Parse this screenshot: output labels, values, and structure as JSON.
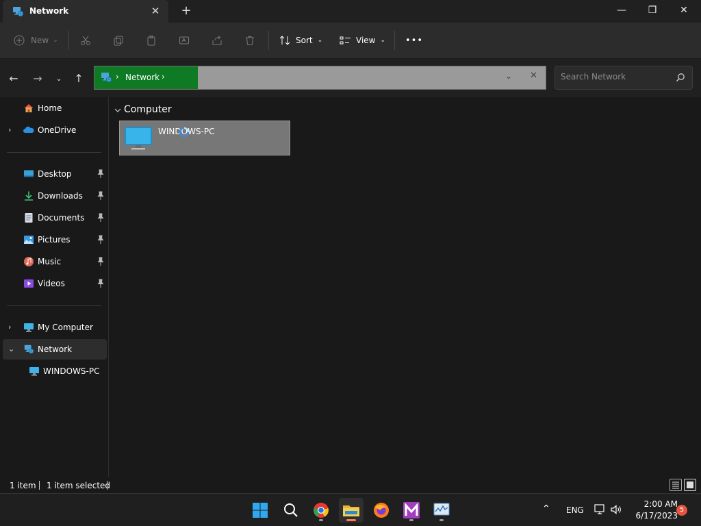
{
  "window": {
    "tab_title": "Network",
    "tab_icon": "network-icon",
    "tab_close": "✕",
    "new_tab": "+",
    "minimize": "—",
    "maximize": "❐",
    "close": "✕"
  },
  "toolbar": {
    "new_label": "New",
    "sort_label": "Sort",
    "view_label": "View",
    "more": "•••"
  },
  "address": {
    "segment": "Network",
    "chevron": "›",
    "dropdown": "⌄",
    "clear": "✕"
  },
  "search": {
    "placeholder": "Search Network"
  },
  "sidebar": {
    "items": [
      {
        "label": "Home",
        "icon": "home-icon"
      },
      {
        "label": "OneDrive",
        "icon": "onedrive-icon"
      },
      {
        "label": "Desktop",
        "icon": "desktop-icon"
      },
      {
        "label": "Downloads",
        "icon": "downloads-icon"
      },
      {
        "label": "Documents",
        "icon": "documents-icon"
      },
      {
        "label": "Pictures",
        "icon": "pictures-icon"
      },
      {
        "label": "Music",
        "icon": "music-icon"
      },
      {
        "label": "Videos",
        "icon": "videos-icon"
      },
      {
        "label": "My Computer",
        "icon": "computer-icon"
      },
      {
        "label": "Network",
        "icon": "network-icon"
      },
      {
        "label": "WINDOWS-PC",
        "icon": "monitor-icon"
      }
    ],
    "selected": "Network"
  },
  "content": {
    "group_header": "Computer",
    "items": [
      {
        "label": "WINDOWS-PC",
        "icon": "monitor-icon"
      }
    ]
  },
  "status": {
    "item_count": "1 item",
    "selection": "1 item selected"
  },
  "taskbar": {
    "apps": [
      "start",
      "search",
      "chrome",
      "file-explorer",
      "firefox",
      "app-m",
      "app-monitor"
    ],
    "active_app": "file-explorer",
    "language": "ENG",
    "time": "2:00 AM",
    "date": "6/17/2023",
    "notifications": "5"
  },
  "colors": {
    "accent": "#0f7a24",
    "selection_tile": "#777777",
    "background": "#191919"
  }
}
